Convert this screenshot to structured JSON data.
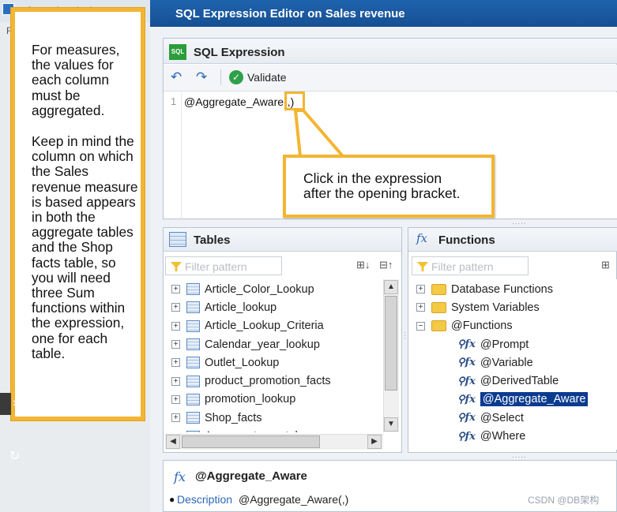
{
  "background_window": {
    "title": "Information design t",
    "letter": "F"
  },
  "note": {
    "paragraph_1": "For measures, the values for each column must be aggregated.",
    "paragraph_2": "Keep in mind the column on which the Sales revenue measure is based appears in both the aggregate tables and the Shop facts table, so you will need three Sum functions within the expression, one for each table."
  },
  "dialog": {
    "title": "SQL Expression Editor on Sales revenue",
    "sql_section": {
      "title": "SQL Expression",
      "validate_label": "Validate",
      "line_number": "1",
      "expression": "@Aggregate_Aware(,)",
      "callout": "Click in the expression\nafter the opening bracket."
    },
    "tables_section": {
      "title": "Tables",
      "filter_placeholder": "Filter pattern",
      "items": [
        "Article_Color_Lookup",
        "Article_lookup",
        "Article_Lookup_Criteria",
        "Calendar_year_lookup",
        "Outlet_Lookup",
        "product_promotion_facts",
        "promotion_lookup",
        "Shop_facts",
        "Agg_yr_qt_rn_st_ln_ca_sr"
      ]
    },
    "functions_section": {
      "title": "Functions",
      "filter_placeholder": "Filter pattern",
      "folders": [
        "Database Functions",
        "System Variables",
        "@Functions"
      ],
      "functions": [
        "@Prompt",
        "@Variable",
        "@DerivedTable",
        "@Aggregate_Aware",
        "@Select",
        "@Where"
      ],
      "selected": "@Aggregate_Aware"
    },
    "description_section": {
      "title": "@Aggregate_Aware",
      "label": "Description",
      "value": "@Aggregate_Aware(,)"
    }
  },
  "watermark": "CSDN @DB架构",
  "colors": {
    "accent_orange": "#f3b532",
    "title_blue": "#1f63ad",
    "selection_blue": "#0b3b8f"
  }
}
